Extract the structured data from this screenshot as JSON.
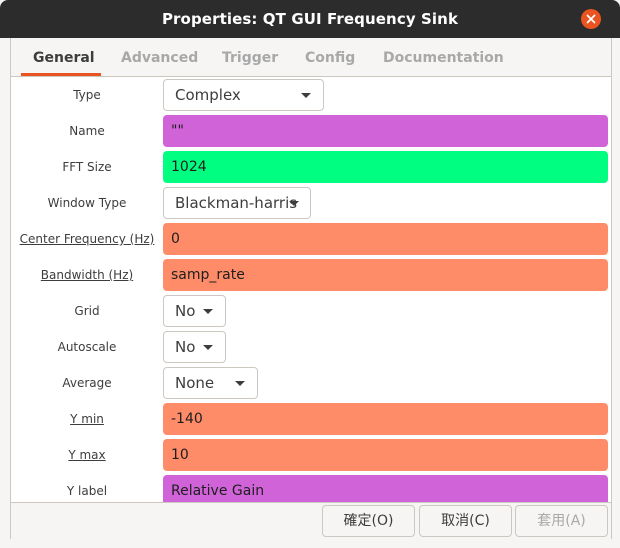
{
  "window": {
    "title": "Properties: QT GUI Frequency Sink"
  },
  "tabs": [
    {
      "label": "General",
      "active": true
    },
    {
      "label": "Advanced"
    },
    {
      "label": "Trigger"
    },
    {
      "label": "Config"
    },
    {
      "label": "Documentation"
    }
  ],
  "rows": [
    {
      "label": "Type",
      "value": "Complex",
      "kind": "dropdown"
    },
    {
      "label": "Name",
      "value": "\"\"",
      "kind": "text",
      "color": "#d163d8"
    },
    {
      "label": "FFT Size",
      "value": "1024",
      "kind": "text",
      "color": "#00ff80"
    },
    {
      "label": "Window Type",
      "value": "Blackman-harris",
      "kind": "dropdown"
    },
    {
      "label": "Center Frequency (Hz)",
      "value": "0",
      "kind": "text",
      "color": "#ff8c69"
    },
    {
      "label": "Bandwidth (Hz)",
      "value": "samp_rate",
      "kind": "text",
      "color": "#ff8c69"
    },
    {
      "label": "Grid",
      "value": "No",
      "kind": "dropdown"
    },
    {
      "label": "Autoscale",
      "value": "No",
      "kind": "dropdown"
    },
    {
      "label": "Average",
      "value": "None",
      "kind": "dropdown"
    },
    {
      "label": "Y min",
      "value": "-140",
      "kind": "text",
      "color": "#ff8c69"
    },
    {
      "label": "Y max",
      "value": "10",
      "kind": "text",
      "color": "#ff8c69"
    },
    {
      "label": "Y label",
      "value": "Relative Gain",
      "kind": "text",
      "color": "#d163d8"
    }
  ],
  "buttons": {
    "ok": "確定(O)",
    "cancel": "取消(C)",
    "apply": "套用(A)"
  },
  "colors": {
    "accent": "#e95420",
    "titlebar": "#2c2c2c"
  }
}
